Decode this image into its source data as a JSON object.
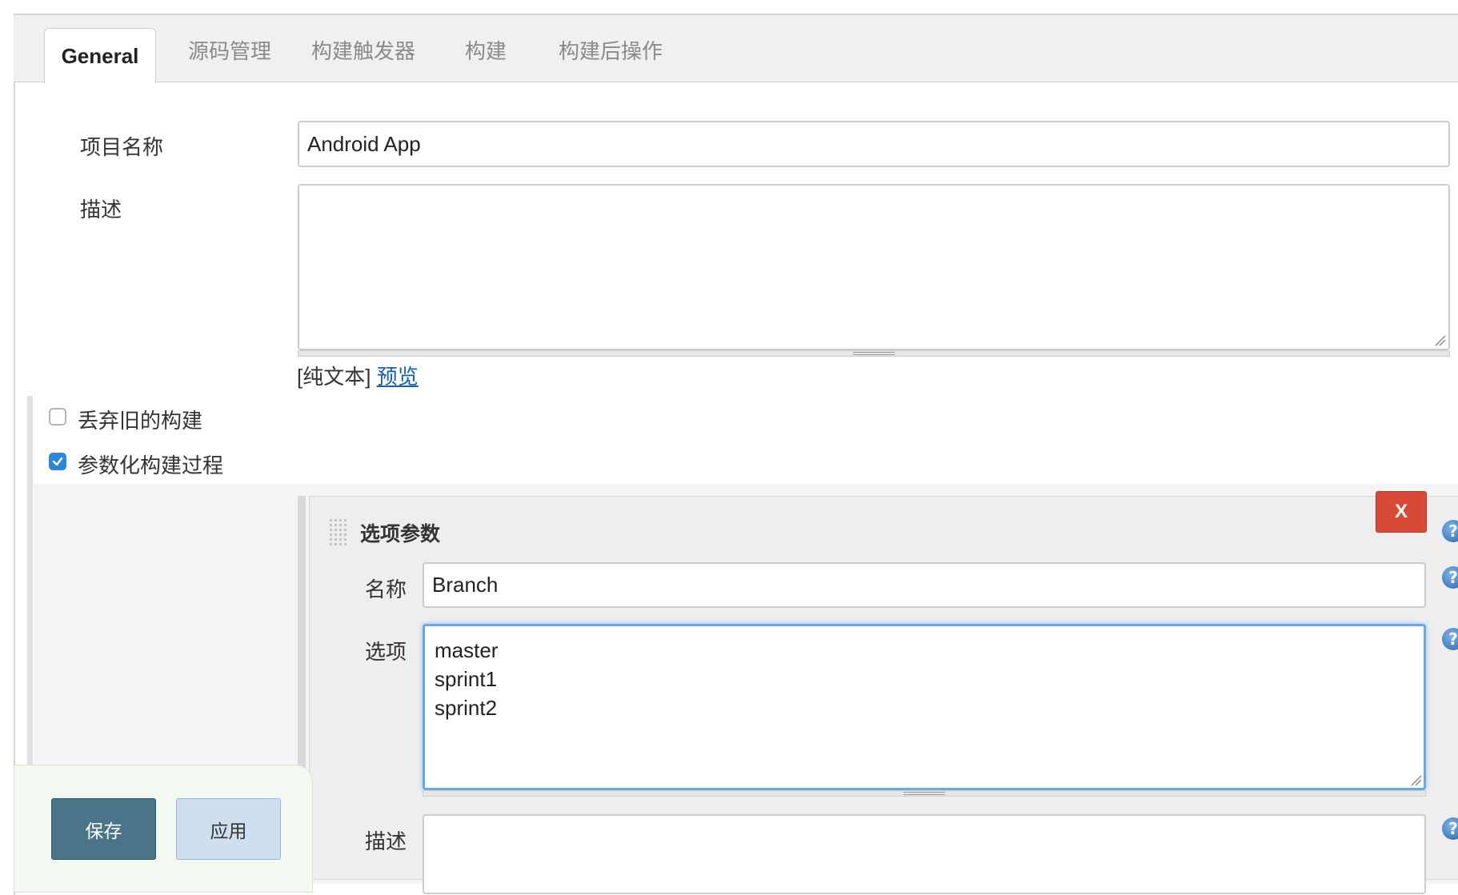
{
  "tabs": [
    {
      "label": "General",
      "active": true
    },
    {
      "label": "源码管理"
    },
    {
      "label": "构建触发器"
    },
    {
      "label": "构建"
    },
    {
      "label": "构建后操作"
    }
  ],
  "general": {
    "project_name_label": "项目名称",
    "project_name_value": "Android App",
    "description_label": "描述",
    "description_value": "",
    "format_prefix": "[纯文本]",
    "preview_link": "预览",
    "discard_old_builds_label": "丢弃旧的构建",
    "discard_old_builds_checked": false,
    "parameterized_label": "参数化构建过程",
    "parameterized_checked": true
  },
  "parameter": {
    "title": "选项参数",
    "delete_label": "X",
    "name_label": "名称",
    "name_value": "Branch",
    "choices_label": "选项",
    "choices_value": "master\nsprint1\nsprint2",
    "description_label": "描述",
    "description_value": ""
  },
  "help_icon_glyph": "?",
  "footer": {
    "save_label": "保存",
    "apply_label": "应用"
  },
  "colors": {
    "accent": "#2f86d9",
    "delete": "#d84a38",
    "save": "#4a7589",
    "apply": "#cfdff0"
  }
}
